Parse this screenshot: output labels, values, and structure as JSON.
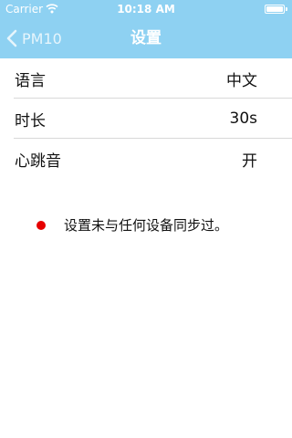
{
  "status_bar": {
    "carrier": "Carrier",
    "time": "10:18 AM",
    "wifi_icon": "wifi-icon",
    "battery_icon": "battery-icon",
    "battery_level": 1.0
  },
  "nav": {
    "back_label": "PM10",
    "title": "设置",
    "background_color": "#8ed1f2",
    "back_icon": "chevron-left-icon"
  },
  "settings": [
    {
      "label": "语言",
      "value": "中文"
    },
    {
      "label": "时长",
      "value": "30s"
    },
    {
      "label": "心跳音",
      "value": "开"
    }
  ],
  "notice": {
    "text": "设置未与任何设备同步过。",
    "dot_color": "#e60000"
  }
}
